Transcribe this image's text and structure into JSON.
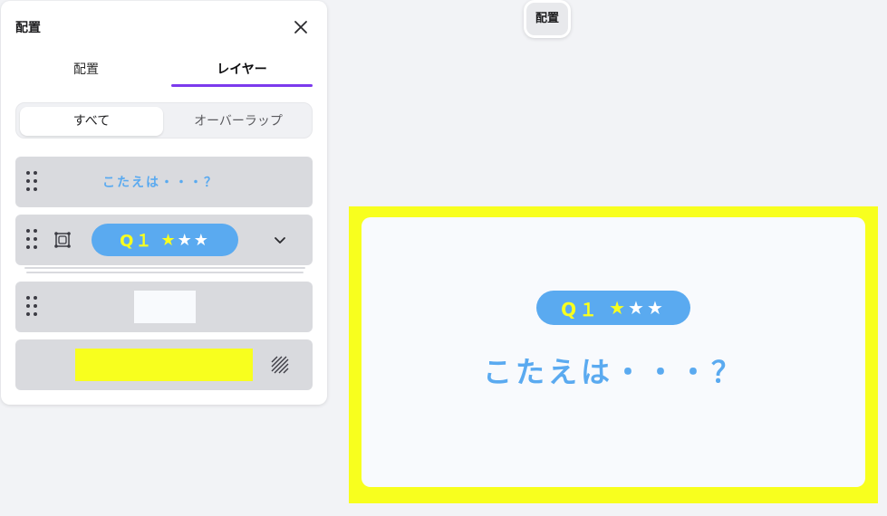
{
  "panel": {
    "title": "配置",
    "tabs": [
      {
        "label": "配置"
      },
      {
        "label": "レイヤー"
      }
    ],
    "segments": [
      {
        "label": "すべて"
      },
      {
        "label": "オーバーラップ"
      }
    ]
  },
  "layers": {
    "text_layer": "こたえは・・・？",
    "group_pill": {
      "q": "Q１",
      "star1": "★",
      "star2": "★",
      "star3": "★"
    }
  },
  "floating_label": "配置",
  "slide": {
    "pill": {
      "q": "Q１",
      "star1": "★",
      "star2": "★",
      "star3": "★"
    },
    "question": "こたえは・・・？"
  },
  "colors": {
    "accent": "#7c3aed",
    "text_blue": "#5aaaf0",
    "yellow": "#f8ff1e"
  },
  "icons": [
    "close-icon",
    "drag-handle-icon",
    "frame-icon",
    "chevron-down-icon",
    "transparency-icon"
  ]
}
